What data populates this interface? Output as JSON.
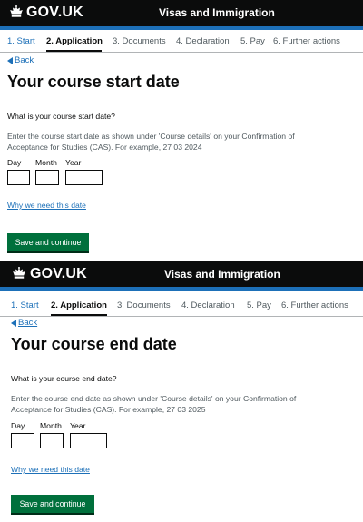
{
  "header": {
    "brand": "GOV.UK",
    "service": "Visas and Immigration",
    "crown_icon": "crown-icon"
  },
  "steps": [
    {
      "label": "1. Start",
      "state": "done"
    },
    {
      "label": "2. Application",
      "state": "current"
    },
    {
      "label": "3. Documents",
      "state": "todo"
    },
    {
      "label": "4. Declaration",
      "state": "todo"
    },
    {
      "label": "5. Pay",
      "state": "todo"
    },
    {
      "label": "6. Further actions",
      "state": "todo"
    }
  ],
  "back_label": "Back",
  "date_labels": {
    "day": "Day",
    "month": "Month",
    "year": "Year"
  },
  "why_link": "Why we need this date",
  "submit_label": "Save and continue",
  "screens": [
    {
      "title": "Your course start date",
      "question": "What is your course start date?",
      "hint": "Enter the course start date as shown under 'Course details' on your Confirmation of Acceptance for Studies (CAS). For example, 27 03 2024",
      "day_value": "",
      "month_value": "",
      "year_value": ""
    },
    {
      "title": "Your course end date",
      "question": "What is your course end date?",
      "hint": "Enter the course end date as shown under 'Course details' on your Confirmation of Acceptance for Studies (CAS). For example, 27 03 2025",
      "day_value": "",
      "month_value": "",
      "year_value": ""
    }
  ],
  "colors": {
    "header_bg": "#0b0c0c",
    "accent_blue": "#1d70b8",
    "button_green": "#00703c",
    "text": "#0b0c0c",
    "hint_text": "#505a5f"
  }
}
